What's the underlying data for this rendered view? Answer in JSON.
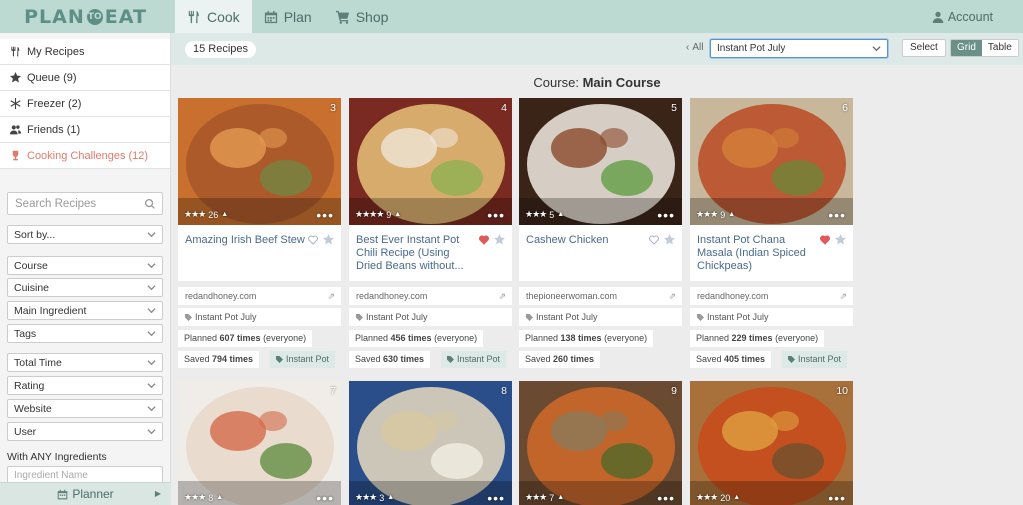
{
  "brand": {
    "logo_left": "PLAN",
    "logo_mark": "TO",
    "logo_right": "EAT"
  },
  "nav": {
    "tabs": [
      {
        "label": "Cook"
      },
      {
        "label": "Plan"
      },
      {
        "label": "Shop"
      }
    ],
    "account": "Account"
  },
  "sidebar": {
    "items": [
      {
        "label": "My Recipes"
      },
      {
        "label": "Queue (9)"
      },
      {
        "label": "Freezer (2)"
      },
      {
        "label": "Friends (1)"
      },
      {
        "label": "Cooking Challenges (12)"
      }
    ],
    "search_placeholder": "Search Recipes",
    "sort": "Sort by...",
    "filters1": [
      "Course",
      "Cuisine",
      "Main Ingredient",
      "Tags"
    ],
    "filters2": [
      "Total Time",
      "Rating",
      "Website",
      "User"
    ],
    "any_label": "With ANY Ingredients",
    "ingredient_placeholder": "Ingredient Name",
    "planner": "Planner"
  },
  "toolbar": {
    "count": "15 Recipes",
    "all": "All",
    "collection": "Instant Pot July",
    "select": "Select",
    "grid": "Grid",
    "table": "Table"
  },
  "course": {
    "prefix": "Course: ",
    "name": "Main Course"
  },
  "cards": [
    {
      "num": "3",
      "stars": "★★★",
      "votes": "26",
      "title": "Amazing Irish Beef Stew",
      "hearted": false,
      "site": "redandhoney.com",
      "collection": "Instant Pot July",
      "planned_count": "607 times",
      "planned_suffix": " (everyone)",
      "saved_count": "794 times",
      "tag": "Instant Pot",
      "colors": [
        "#c9702e",
        "#a8562a",
        "#e29a50",
        "#6f8a45"
      ]
    },
    {
      "num": "4",
      "stars": "★★★★",
      "votes": "9",
      "title": "Best Ever Instant Pot Chili Recipe (Using Dried Beans without...",
      "hearted": true,
      "site": "redandhoney.com",
      "collection": "Instant Pot July",
      "planned_count": "456 times",
      "planned_suffix": " (everyone)",
      "saved_count": "630 times",
      "tag": "Instant Pot",
      "colors": [
        "#7a2a20",
        "#e8c27a",
        "#f0e6d8",
        "#8ab050"
      ]
    },
    {
      "num": "5",
      "stars": "★★★",
      "votes": "5",
      "title": "Cashew Chicken",
      "hearted": false,
      "site": "thepioneerwoman.com",
      "collection": "Instant Pot July",
      "planned_count": "138 times",
      "planned_suffix": " (everyone)",
      "saved_count": "260 times",
      "tag": "",
      "colors": [
        "#3a2418",
        "#f2ece4",
        "#8b4a2a",
        "#5a9a3a"
      ]
    },
    {
      "num": "6",
      "stars": "★★★",
      "votes": "9",
      "title": "Instant Pot Chana Masala (Indian Spiced Chickpeas)",
      "hearted": true,
      "site": "redandhoney.com",
      "collection": "Instant Pot July",
      "planned_count": "229 times",
      "planned_suffix": " (everyone)",
      "saved_count": "405 times",
      "tag": "Instant Pot",
      "colors": [
        "#c8b79a",
        "#b84a22",
        "#d4803a",
        "#6a8a3a"
      ]
    },
    {
      "num": "7",
      "stars": "★★★",
      "votes": "8",
      "colors": [
        "#f0ece8",
        "#e8d8c8",
        "#d46a4a",
        "#5a8a3a"
      ]
    },
    {
      "num": "8",
      "stars": "★★★",
      "votes": "3",
      "colors": [
        "#2a4e8a",
        "#e8dcc0",
        "#d8c8a0",
        "#f5f0e6"
      ]
    },
    {
      "num": "9",
      "stars": "★★★",
      "votes": "7",
      "colors": [
        "#6a4a30",
        "#d06a2a",
        "#8a7a5a",
        "#4a6a2a"
      ]
    },
    {
      "num": "10",
      "stars": "★★★",
      "votes": "20",
      "colors": [
        "#a8703a",
        "#c84a1a",
        "#e0a040",
        "#6a5030"
      ]
    }
  ]
}
